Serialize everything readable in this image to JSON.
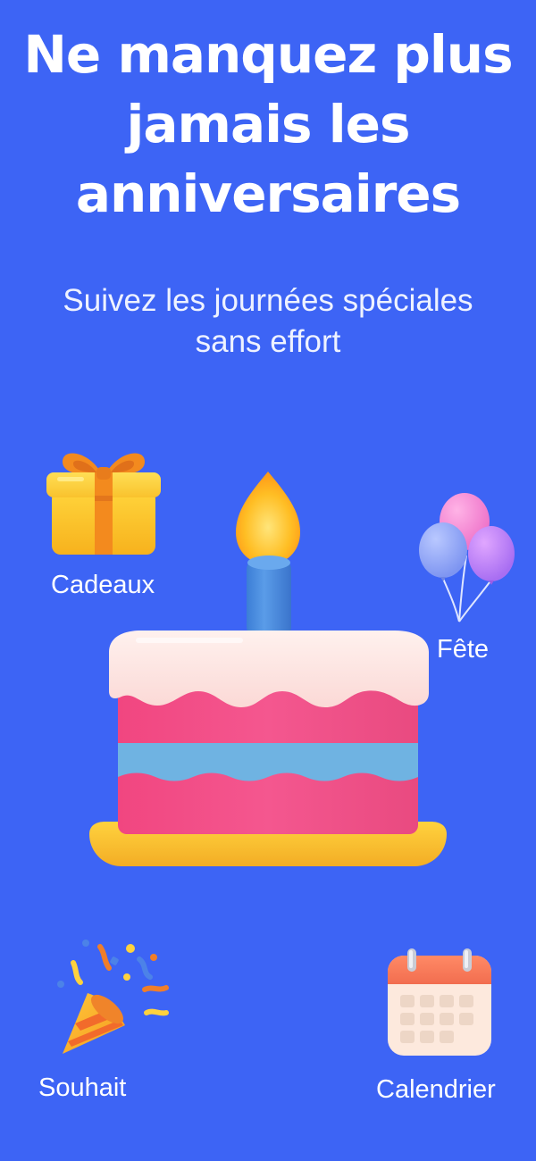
{
  "onboarding": {
    "title_lines": [
      "Ne manquez plus",
      "jamais les",
      "anniversaires"
    ],
    "subtitle_lines": [
      "Suivez les journées spéciales",
      "sans effort"
    ]
  },
  "features": {
    "gifts": {
      "label": "Cadeaux",
      "icon": "gift-icon"
    },
    "party": {
      "label": "Fête",
      "icon": "balloons-icon"
    },
    "wish": {
      "label": "Souhait",
      "icon": "party-popper-icon"
    },
    "calendar": {
      "label": "Calendrier",
      "icon": "calendar-icon"
    }
  },
  "hero": {
    "icon": "birthday-cake-icon"
  },
  "colors": {
    "background": "#3d64f5",
    "text": "#ffffff",
    "cake_body": "#f2508a",
    "cake_frosting": "#fde6e4",
    "cake_stripe": "#6fb3e2",
    "cake_plate": "#fbc43c",
    "candle": "#4a8fe0",
    "flame": "#ffb21f"
  }
}
